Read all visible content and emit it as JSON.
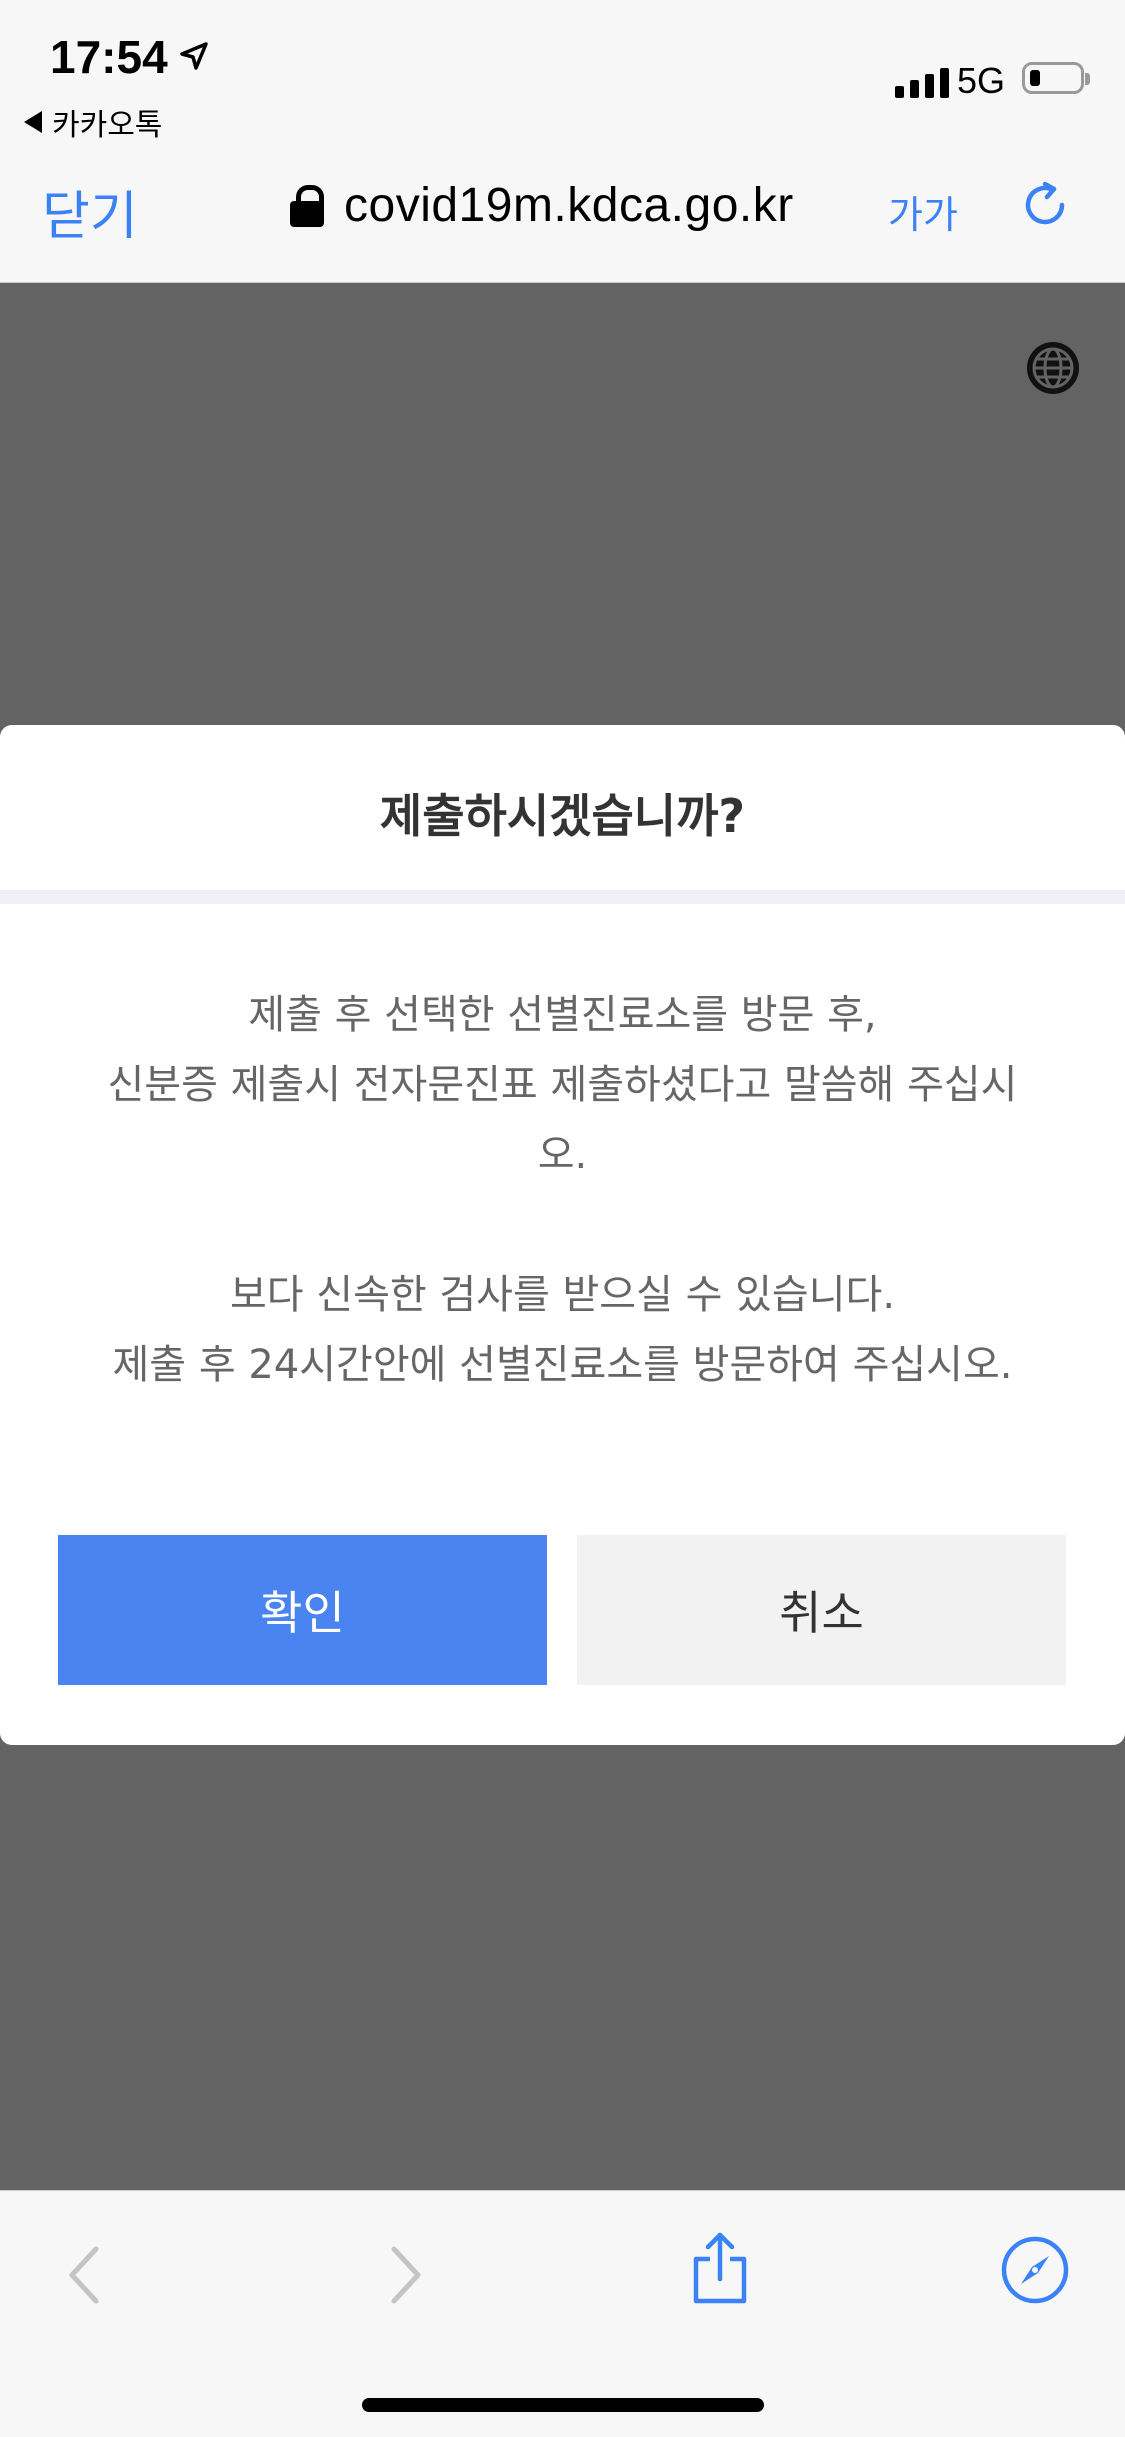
{
  "status_bar": {
    "time": "17:54",
    "back_app": "카카오톡",
    "network": "5G"
  },
  "browser": {
    "close_label": "닫기",
    "url": "covid19m.kdca.go.kr",
    "text_size_label": "가가",
    "accent_color": "#3b82f6"
  },
  "dialog": {
    "title": "제출하시겠습니까?",
    "message_lines": [
      "제출 후 선택한 선별진료소를 방문 후,",
      "신분증 제출시 전자문진표 제출하셨다고 말씀해 주십시",
      "오."
    ],
    "message_lines_2": [
      "보다 신속한 검사를 받으실 수 있습니다.",
      "제출 후 24시간안에 선별진료소를 방문하여 주십시오."
    ],
    "confirm_label": "확인",
    "cancel_label": "취소",
    "confirm_color": "#4a84f0"
  },
  "toolbar": {
    "icons": [
      "back-icon",
      "forward-icon",
      "share-icon",
      "compass-icon"
    ]
  }
}
